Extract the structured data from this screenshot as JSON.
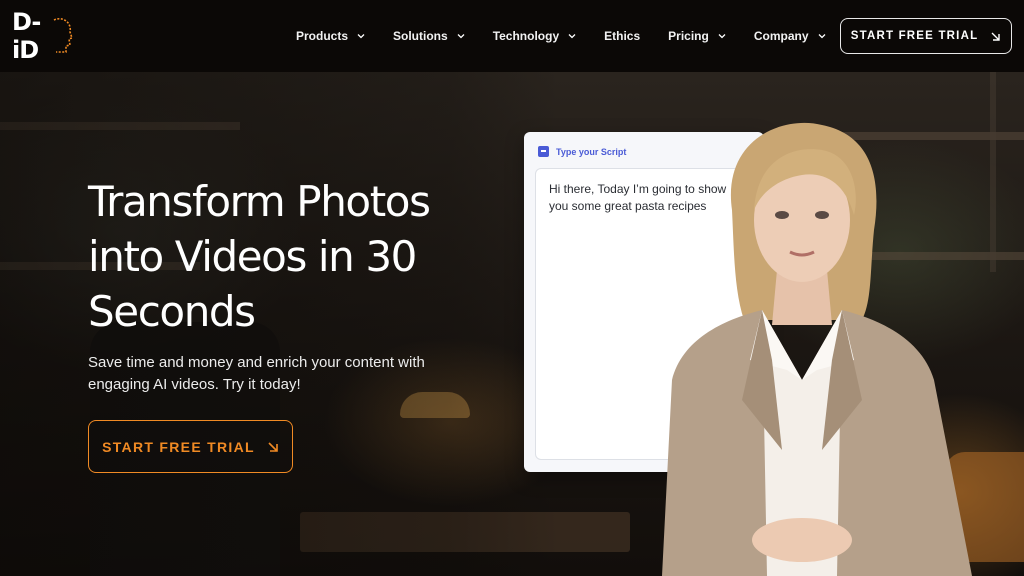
{
  "header": {
    "logo_text": "D-iD",
    "nav": [
      {
        "label": "Products",
        "has_dropdown": true
      },
      {
        "label": "Solutions",
        "has_dropdown": true
      },
      {
        "label": "Technology",
        "has_dropdown": true
      },
      {
        "label": "Ethics",
        "has_dropdown": false
      },
      {
        "label": "Pricing",
        "has_dropdown": true
      },
      {
        "label": "Company",
        "has_dropdown": true
      }
    ],
    "cta_label": "START FREE TRIAL"
  },
  "hero": {
    "title": "Transform Photos into Videos in 30 Seconds",
    "subtitle": "Save time and money and enrich your content with engaging AI videos. Try it today!",
    "cta_label": "START FREE TRIAL"
  },
  "script_card": {
    "label": "Type your Script",
    "text": "Hi there, Today I’m going to show you some great pasta recipes"
  },
  "colors": {
    "accent": "#f08a24",
    "header_bg": "#0b0806",
    "card_label": "#4a5bd6"
  },
  "icons": {
    "logo_head": "head-profile-icon",
    "nav_dropdown": "chevron-down-icon",
    "cta_arrow": "arrow-down-right-icon",
    "script": "script-icon"
  }
}
